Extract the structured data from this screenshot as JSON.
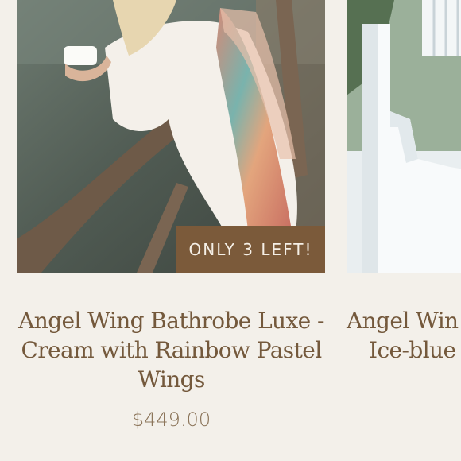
{
  "products": [
    {
      "title": "Angel Wing Bathrobe Luxe - Cream with Rainbow Pastel Wings",
      "price": "$449.00",
      "badge": "ONLY 3 LEFT!",
      "image_description": "woman in cream robe with rainbow pastel wings holding a mug by a wooden railing"
    },
    {
      "title_line1": "Angel Win",
      "title_line2": "Ice-blue"
    }
  ]
}
